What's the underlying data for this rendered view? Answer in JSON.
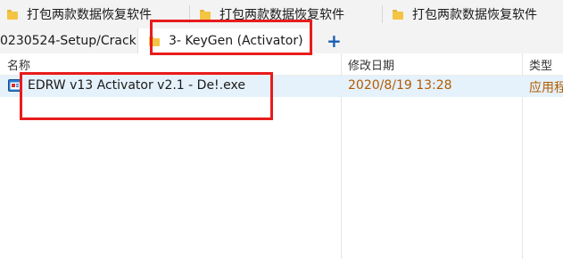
{
  "tabs_row1": [
    {
      "label": "打包两款数据恢复软件"
    },
    {
      "label": "打包两款数据恢复软件"
    },
    {
      "label": "打包两款数据恢复软件"
    }
  ],
  "tabs_row2": {
    "partial_tab": "0230524-Setup/Crack",
    "active_tab": "3- KeyGen (Activator)",
    "new_tab_symbol": "+"
  },
  "columns": {
    "name": "名称",
    "date_modified": "修改日期",
    "type": "类型"
  },
  "files": [
    {
      "name": "EDRW v13 Activator v2.1 - De!.exe",
      "date": "2020/8/19 13:28",
      "type": "应用程序"
    }
  ],
  "colors": {
    "highlight": "#e81c1c",
    "date_text": "#b25c00",
    "selection": "#e5f1fb"
  }
}
